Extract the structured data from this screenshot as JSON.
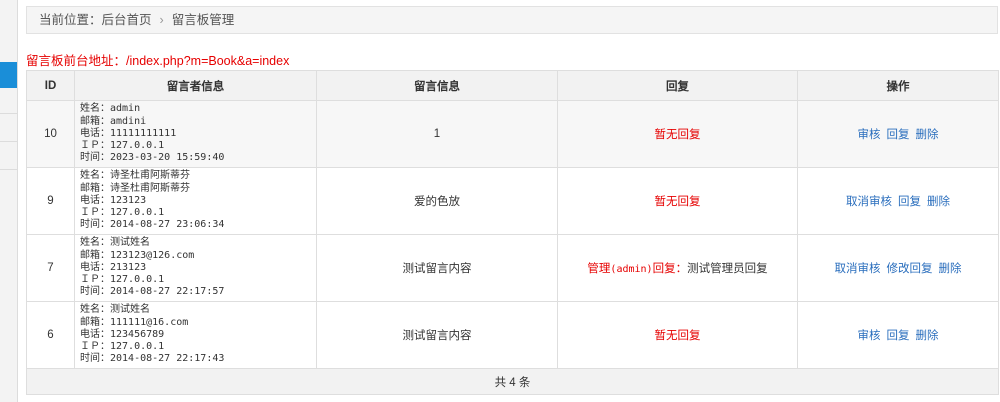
{
  "breadcrumb": {
    "prefix": "当前位置：",
    "home": "后台首页",
    "separator": "›",
    "current": "留言板管理"
  },
  "front_url": {
    "label": "留言板前台地址：",
    "url": "/index.php?m=Book&a=index"
  },
  "table": {
    "headers": [
      "ID",
      "留言者信息",
      "留言信息",
      "回复",
      "操作"
    ],
    "rows": [
      {
        "id": "10",
        "info": [
          "姓名：admin",
          "邮箱：amdini",
          "电话：11111111111",
          "ＩＰ：127.0.0.1",
          "时间：2023-03-20 15:59:40"
        ],
        "message": "1",
        "reply_none": "暂无回复",
        "ops": [
          "审核",
          "回复",
          "删除"
        ]
      },
      {
        "id": "9",
        "info": [
          "姓名：诗圣杜甫阿斯蒂芬",
          "邮箱：诗圣杜甫阿斯蒂芬",
          "电话：123123",
          "ＩＰ：127.0.0.1",
          "时间：2014-08-27 23:06:34"
        ],
        "message": "爱的色放",
        "reply_none": "暂无回复",
        "ops": [
          "取消审核",
          "回复",
          "删除"
        ]
      },
      {
        "id": "7",
        "info": [
          "姓名：测试姓名",
          "邮箱：123123@126.com",
          "电话：213123",
          "ＩＰ：127.0.0.1",
          "时间：2014-08-27 22:17:57"
        ],
        "message": "测试留言内容",
        "reply_prefix": "管理",
        "reply_admin": "(admin)",
        "reply_suffix": "回复：",
        "reply_text": "测试管理员回复",
        "ops": [
          "取消审核",
          "修改回复",
          "删除"
        ]
      },
      {
        "id": "6",
        "info": [
          "姓名：测试姓名",
          "邮箱：111111@16.com",
          "电话：123456789",
          "ＩＰ：127.0.0.1",
          "时间：2014-08-27 22:17:43"
        ],
        "message": "测试留言内容",
        "reply_none": "暂无回复",
        "ops": [
          "审核",
          "回复",
          "删除"
        ]
      }
    ],
    "footer": "共 4 条"
  },
  "colors": {
    "accent": "#1a8ed8",
    "red": "#e60000",
    "link": "#2a6ebd"
  }
}
